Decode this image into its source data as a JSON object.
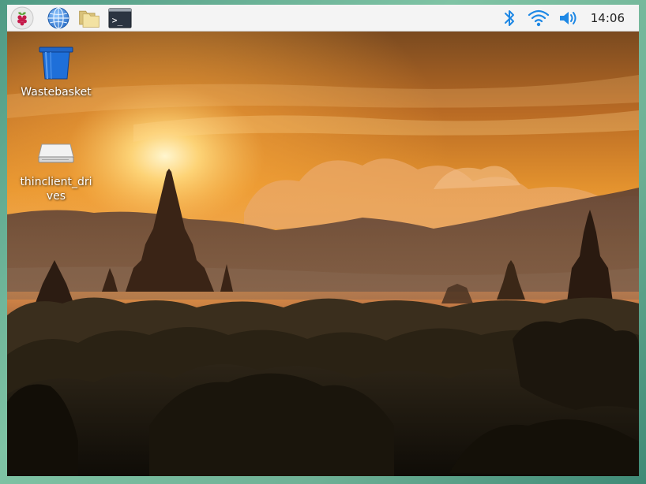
{
  "taskbar": {
    "launchers": [
      {
        "name": "menu",
        "icon": "raspberry-icon"
      },
      {
        "name": "web-browser",
        "icon": "globe-icon"
      },
      {
        "name": "file-manager",
        "icon": "folder-icon"
      },
      {
        "name": "terminal",
        "icon": "terminal-icon",
        "prompt": ">_"
      }
    ],
    "tray": {
      "bluetooth_icon": "bluetooth-icon",
      "wifi_icon": "wifi-icon",
      "volume_icon": "volume-icon",
      "clock": "14:06"
    },
    "colors": {
      "tray_blue": "#1e88e5",
      "bar_bg": "#f4f4f4"
    }
  },
  "desktop": {
    "icons": [
      {
        "label": "Wastebasket",
        "icon": "trash-icon"
      },
      {
        "label": "thinclient_drives",
        "icon": "drive-icon"
      }
    ]
  }
}
